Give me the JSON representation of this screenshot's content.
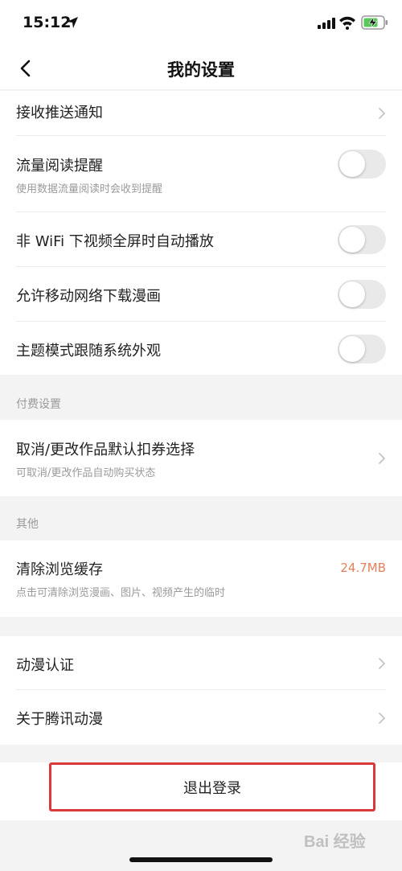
{
  "status_bar": {
    "time": "15:12"
  },
  "nav": {
    "title": "我的设置"
  },
  "settings": {
    "push": {
      "title": "接收推送通知"
    },
    "traffic": {
      "title": "流量阅读提醒",
      "subtitle": "使用数据流量阅读时会收到提醒"
    },
    "autoplay": {
      "title": "非 WiFi 下视频全屏时自动播放"
    },
    "download": {
      "title": "允许移动网络下载漫画"
    },
    "theme": {
      "title": "主题模式跟随系统外观"
    }
  },
  "pay_section": {
    "header": "付费设置",
    "cancel": {
      "title": "取消/更改作品默认扣券选择",
      "subtitle": "可取消/更改作品自动购买状态"
    }
  },
  "other_section": {
    "header": "其他",
    "cache": {
      "title": "清除浏览缓存",
      "subtitle": "点击可清除浏览漫画、图片、视频产生的临时",
      "size": "24.7MB"
    }
  },
  "misc": {
    "certification": {
      "title": "动漫认证"
    },
    "about": {
      "title": "关于腾讯动漫"
    }
  },
  "logout": {
    "label": "退出登录"
  },
  "toggles": {
    "traffic": false,
    "autoplay": false,
    "download": false,
    "theme": false
  },
  "watermark": "Bai 经验",
  "colors": {
    "accent_size": "#e4805b",
    "logout_border": "#d9393b",
    "toggle_off": "#e9e9ea"
  }
}
